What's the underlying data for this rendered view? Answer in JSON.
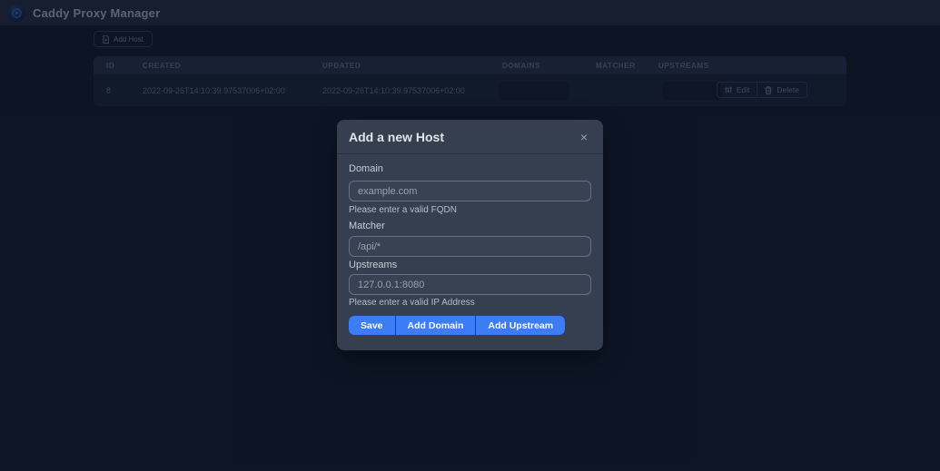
{
  "app": {
    "title": "Caddy Proxy Manager"
  },
  "toolbar": {
    "add_host_label": "Add Host"
  },
  "table": {
    "columns": [
      "ID",
      "CREATED",
      "UPDATED",
      "DOMAINS",
      "MATCHER",
      "UPSTREAMS"
    ],
    "rows": [
      {
        "id": "8",
        "created": "2022-09-26T14:10:39.97537006+02:00",
        "updated": "2022-09-26T14:10:39.97537006+02:00",
        "domains": "",
        "matcher": "",
        "upstreams": "",
        "edit_label": "Edit",
        "delete_label": "Delete"
      }
    ]
  },
  "modal": {
    "title": "Add a new Host",
    "close_icon": "×",
    "fields": {
      "domain": {
        "label": "Domain",
        "value": "",
        "placeholder": "example.com",
        "helper": "Please enter a valid FQDN"
      },
      "matcher": {
        "label": "Matcher",
        "value": "",
        "placeholder": "/api/*"
      },
      "upstreams": {
        "label": "Upstreams",
        "value": "",
        "placeholder": "127.0.0.1:8080",
        "helper": "Please enter a valid IP Address"
      }
    },
    "buttons": {
      "save": "Save",
      "add_domain": "Add Domain",
      "add_upstream": "Add Upstream"
    }
  },
  "icons": {
    "logo": "caddy-logo",
    "add_host": "file-plus-icon",
    "edit": "sliders-icon",
    "delete": "trash-icon",
    "close": "close-icon"
  },
  "colors": {
    "accent_blue": "#3c7df6",
    "header_bg": "#263043",
    "page_bg": "#16202f",
    "modal_bg": "#353f4f",
    "table_header_bg": "#28334a",
    "table_row_bg": "#1d2839"
  }
}
